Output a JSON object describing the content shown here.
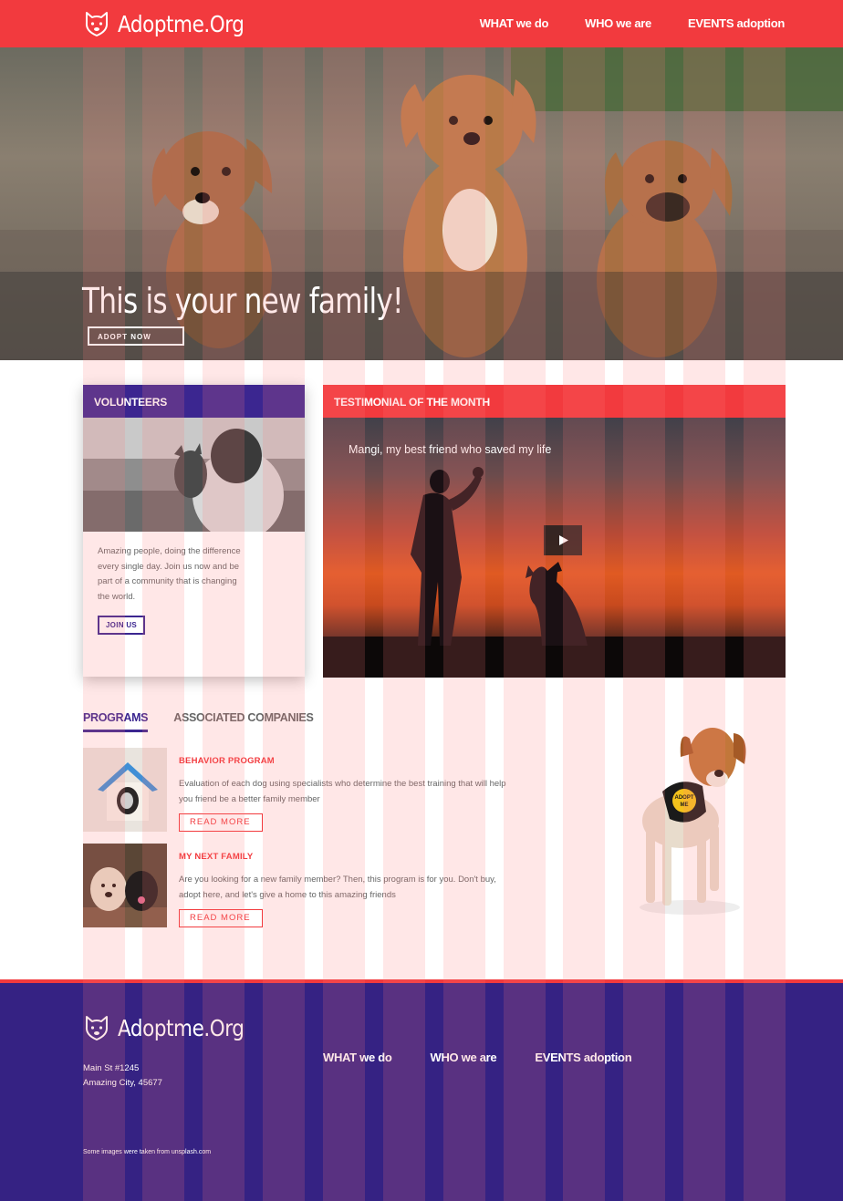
{
  "header": {
    "logo_text": "Adoptme.Org",
    "nav": [
      "WHAT we do",
      "WHO we are",
      "EVENTS adoption"
    ]
  },
  "hero": {
    "title": "This is your new family!",
    "button": "ADOPT NOW"
  },
  "volunteers": {
    "heading": "VOLUNTEERS",
    "text": "Amazing people, doing the difference every single day. Join us now and be part of a community that is changing the world.",
    "button": "JOIN US"
  },
  "testimonial": {
    "heading": "TESTIMONIAL OF THE MONTH",
    "quote": "Mangi, my best friend who saved my life"
  },
  "tabs": [
    "PROGRAMS",
    "ASSOCIATED COMPANIES"
  ],
  "programs": [
    {
      "title": "BEHAVIOR PROGRAM",
      "description": "Evaluation of each dog using specialists who determine the best training that will help you friend be a better family member",
      "button": "READ MORE"
    },
    {
      "title": "MY NEXT FAMILY",
      "description": "Are you looking for a new family member? Then, this program is for you. Don't buy, adopt here, and let's give a home to this amazing friends",
      "button": "READ MORE"
    }
  ],
  "side_badge": "ADOPT ME",
  "footer": {
    "logo_text": "Adoptme.Org",
    "address_line1": "Main St #1245",
    "address_line2": "Amazing City, 45677",
    "nav": [
      "WHAT we do",
      "WHO we are",
      "EVENTS adoption"
    ],
    "note": "Some images were taken from unsplash.com"
  },
  "colors": {
    "brand_red": "#f23a3e",
    "brand_purple": "#3b2690",
    "footer_purple": "#352283"
  }
}
